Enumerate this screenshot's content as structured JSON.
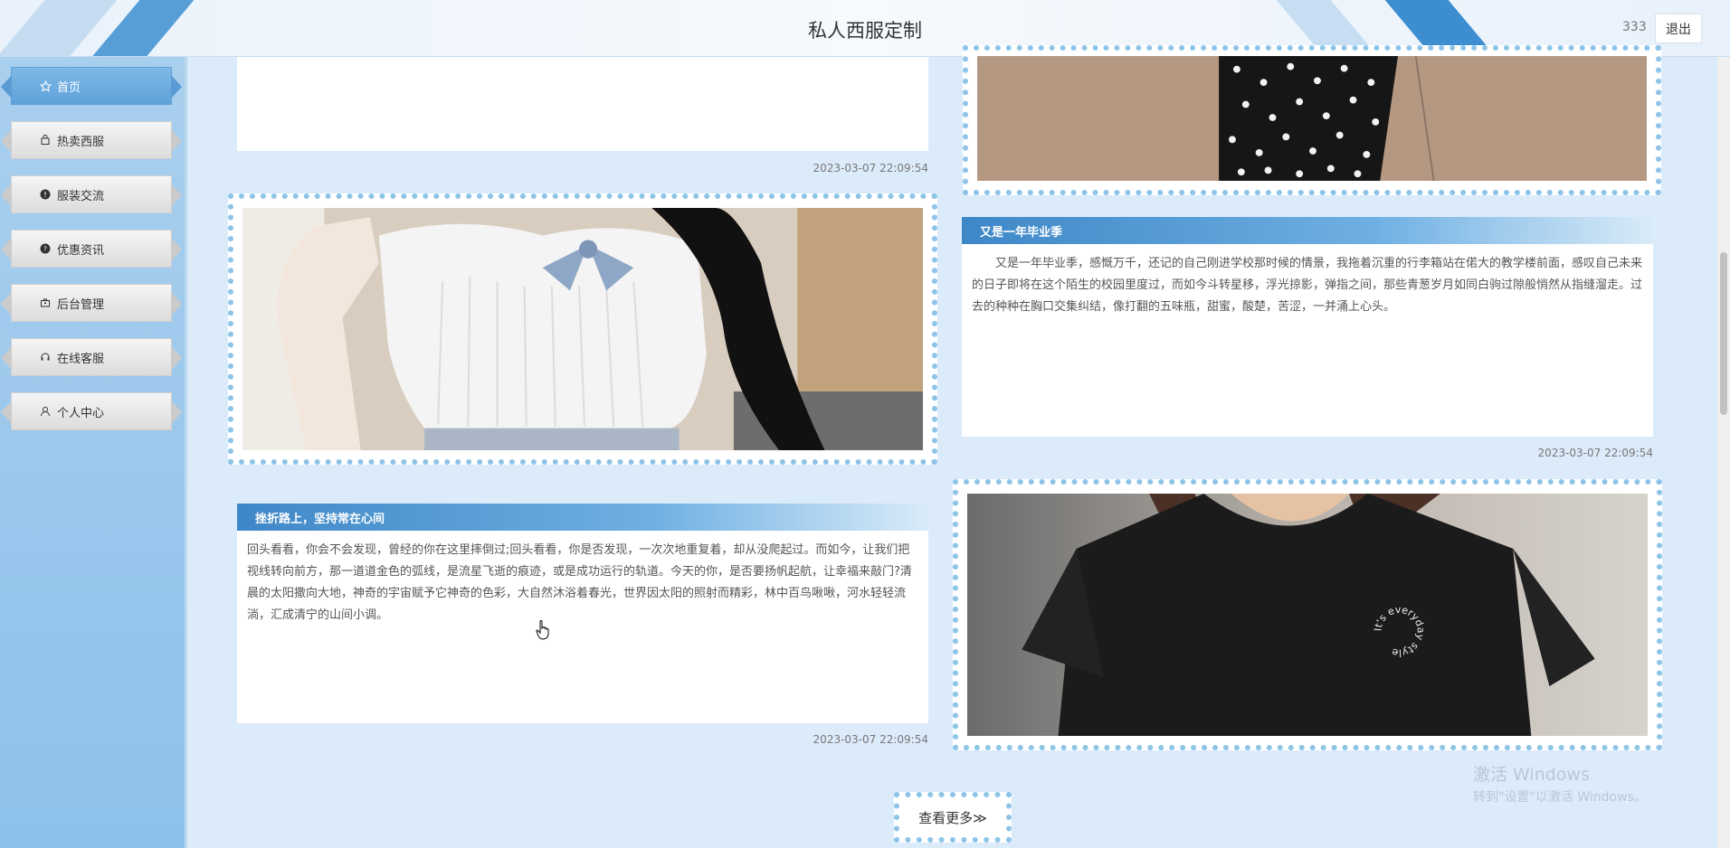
{
  "header": {
    "title": "私人西服定制",
    "username": "333",
    "logout_label": "退出"
  },
  "sidebar": {
    "items": [
      {
        "label": "首页",
        "icon": "star-icon",
        "active": true
      },
      {
        "label": "热卖西服",
        "icon": "bag-icon",
        "active": false
      },
      {
        "label": "服装交流",
        "icon": "alert-circle-icon",
        "active": false
      },
      {
        "label": "优惠资讯",
        "icon": "help-circle-icon",
        "active": false
      },
      {
        "label": "后台管理",
        "icon": "toolbox-icon",
        "active": false
      },
      {
        "label": "在线客服",
        "icon": "headset-icon",
        "active": false
      },
      {
        "label": "个人中心",
        "icon": "user-icon",
        "active": false
      }
    ]
  },
  "news": {
    "top_left_date": "2023-03-07 22:09:54",
    "graduation": {
      "title": "又是一年毕业季",
      "text": "又是一年毕业季，感慨万千，还记的自己刚进学校那时候的情景，我拖着沉重的行李箱站在偌大的教学楼前面，感叹自己未来的日子即将在这个陌生的校园里度过，而如今斗转星移，浮光掠影，弹指之间，那些青葱岁月如同白驹过隙般悄然从指缝溜走。过去的种种在胸口交集纠结，像打翻的五味瓶，甜蜜，酸楚，苦涩，一并涌上心头。",
      "date": "2023-03-07 22:09:54"
    },
    "frustration": {
      "title": "挫折路上，坚持常在心间",
      "text": "回头看看，你会不会发现，曾经的你在这里摔倒过;回头看看，你是否发现，一次次地重复着，却从没爬起过。而如今，让我们把视线转向前方，那一道道金色的弧线，是流星飞逝的痕迹，或是成功运行的轨道。今天的你，是否要扬帆起航，让幸福来敲门?清晨的太阳撒向大地，神奇的宇宙赋予它神奇的色彩，大自然沐浴着春光，世界因太阳的照射而精彩，林中百鸟啾啾，河水轻轻流淌，汇成清宁的山间小调。",
      "date": "2023-03-07 22:09:54"
    },
    "tshirt_print": "It's everyday style"
  },
  "more_label": "查看更多≫",
  "watermark": {
    "line1": "激活 Windows",
    "line2": "转到\"设置\"以激活 Windows。"
  },
  "colors": {
    "accent": "#3e87c7",
    "sidebar": "#8ec1ea",
    "frame_dots": "#8dc4e8",
    "background": "#dcebfa"
  }
}
